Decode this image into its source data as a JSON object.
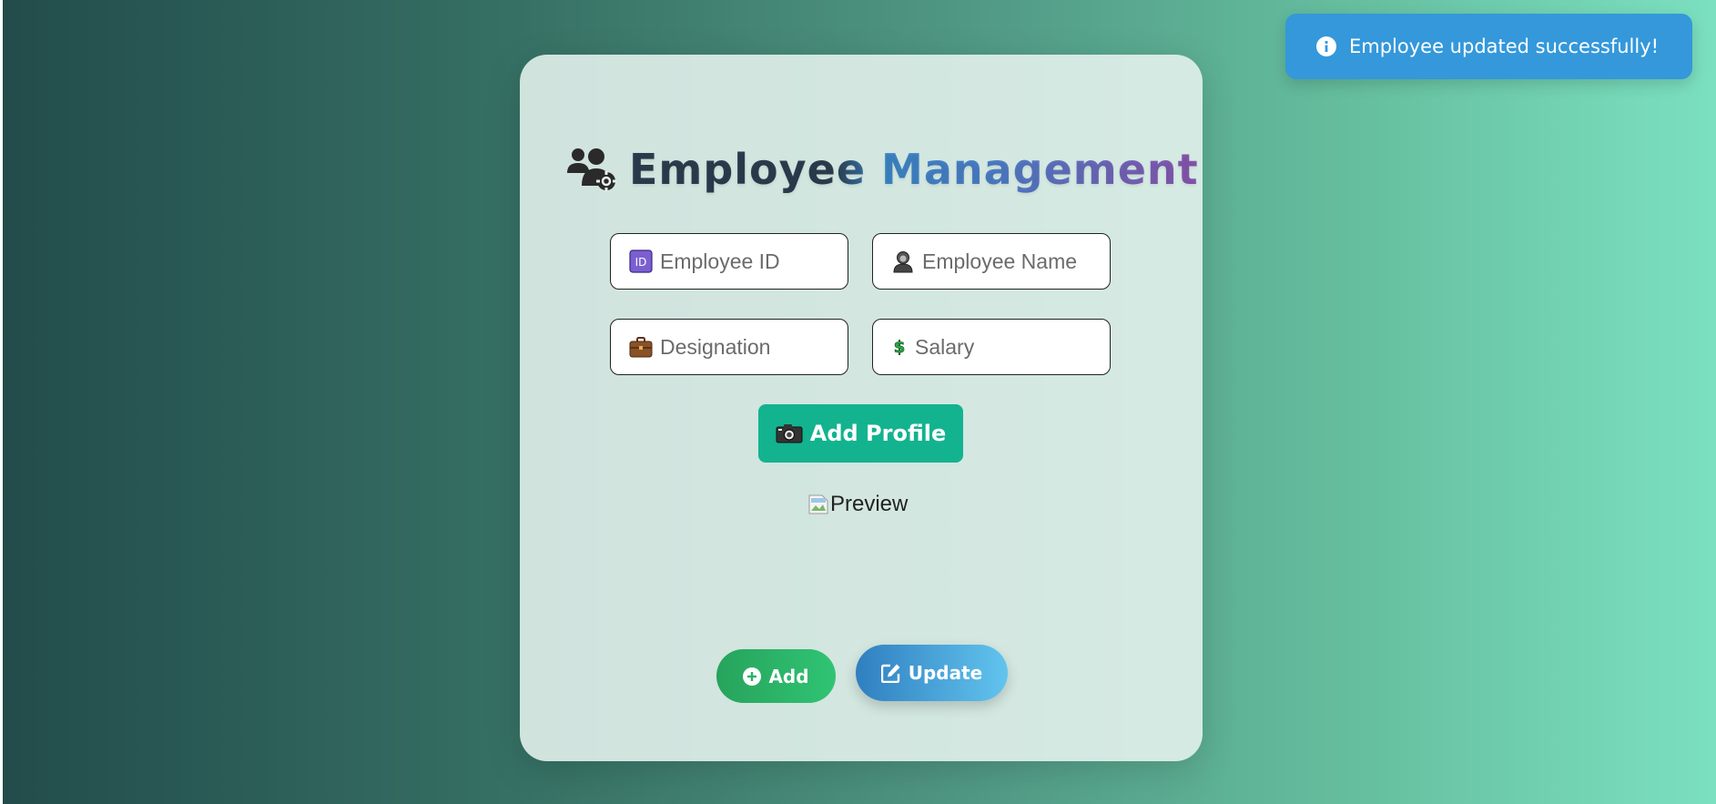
{
  "header": {
    "title": "Employee Management",
    "icon": "users-cog-icon"
  },
  "form": {
    "employee_id": {
      "placeholder": "Employee ID",
      "value": "",
      "icon": "id-badge-icon"
    },
    "employee_name": {
      "placeholder": "Employee Name",
      "value": "",
      "icon": "person-icon"
    },
    "designation": {
      "placeholder": "Designation",
      "value": "",
      "icon": "briefcase-icon"
    },
    "salary": {
      "placeholder": "Salary",
      "value": "",
      "icon": "dollar-icon"
    }
  },
  "profile": {
    "button_label": "Add Profile",
    "button_icon": "camera-icon",
    "preview_alt": "Preview"
  },
  "actions": {
    "add_label": "Add",
    "update_label": "Update"
  },
  "toast": {
    "message": "Employee updated successfully!",
    "icon": "info-icon"
  },
  "colors": {
    "primary_green": "#13b38f",
    "add_green": "#30c474",
    "update_blue": "#3498db",
    "toast_blue": "#3498db",
    "title_dark": "#2d3e50",
    "title_purple": "#8b55b0"
  }
}
